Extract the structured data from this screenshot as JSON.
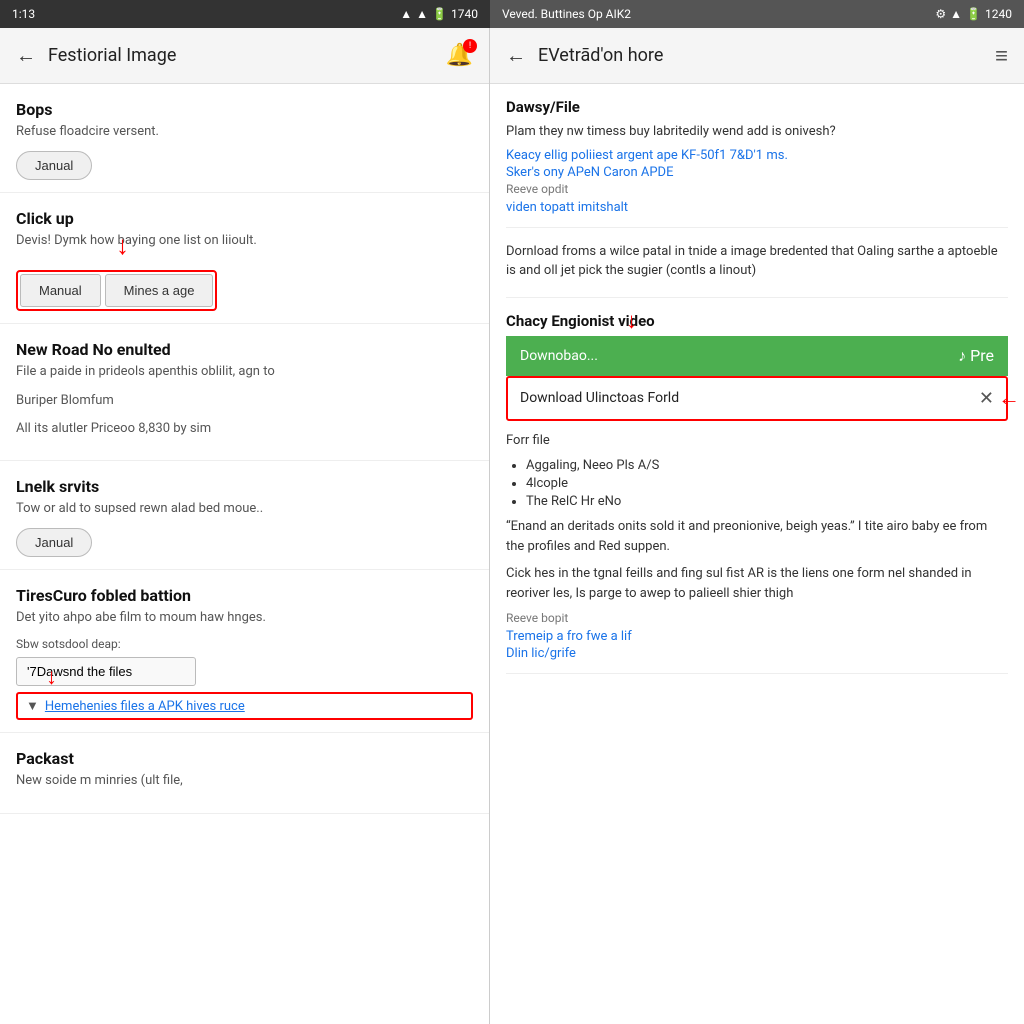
{
  "left_status": {
    "time": "1:13",
    "battery": "1740"
  },
  "right_status": {
    "notification": "Veved. Buttines Op AIK2",
    "battery": "1240"
  },
  "left_panel": {
    "title": "Festiorial Image",
    "sections": [
      {
        "id": "bops",
        "title": "Bops",
        "desc": "Refuse floadcire versent.",
        "button_label": "Janual"
      },
      {
        "id": "click_up",
        "title": "Click up",
        "desc": "Devis! Dymk how baying one list on liioult.",
        "btn1": "Manual",
        "btn2": "Mines a age"
      },
      {
        "id": "new_road",
        "title": "New Road No enulted",
        "desc1": "File a paide in prideols apenthis oblilit, agn to",
        "desc2": "Buriper Blomfum",
        "desc3": "All its alutler Priceoo 8,830 by sim"
      },
      {
        "id": "lnelk",
        "title": "Lnelk srvits",
        "desc": "Tow or ald to supsed rewn alad bed moue..",
        "button_label": "Janual"
      },
      {
        "id": "tirescuro",
        "title": "TiresCuro fobled battion",
        "desc": "Det yito ahpo abe film to moum haw hnges.",
        "sub_label": "Sbw sotsdool deap:",
        "input_value": "'7Dawsnd the files",
        "link_text": "Hemehenies files a APK hives ruce"
      }
    ],
    "bottom_section": {
      "title": "Packast",
      "desc": "New soide m minries (ult file,"
    }
  },
  "right_panel": {
    "title": "EVetrād'on hore",
    "sections": [
      {
        "id": "dawsy_file",
        "title": "Dawsy/File",
        "body": "Plam they nw timess buy labritedily wend add is onivesh?",
        "link1": "Keacy ellig poliiest argent ape KF-50f1 7&D'1 ms.",
        "link2": "Sker's ony APeN Caron APDE",
        "gray_text": "Reeve opdit",
        "link3": "viden topatt imitshalt"
      },
      {
        "id": "download_info",
        "body": "Dornload froms a wilce patal in tnide a image bredented that Oaling sarthe a aptoeble is and oll jet pick the sugier (contls a linout)"
      },
      {
        "id": "chacy_video",
        "title": "Chacy Engionist video",
        "green_bar_text": "Downobao...",
        "green_bar_right": "♪ Pre",
        "download_field": "Download Ulinctoas Forld",
        "for_file_title": "Forr file",
        "bullets": [
          "Aggaling, Neeo Pls A/S",
          "4lcople",
          "The RelC Hr eNo"
        ],
        "quote_text": "“Enand an deritads onits sold it and preonionive, beigh yeas.” I tite airo baby ee from the profiles and Red suppen.",
        "cick_text": "Cick hes in the tgnal feills and fing sul fist AR is the liens one form nel shanded in reoriver les, Is parge to awep to palieell shier thigh",
        "gray_text2": "Reeve bopit",
        "link4": "Tremeip a fro fwe a lif",
        "link5": "Dlin lic/grife"
      }
    ]
  }
}
